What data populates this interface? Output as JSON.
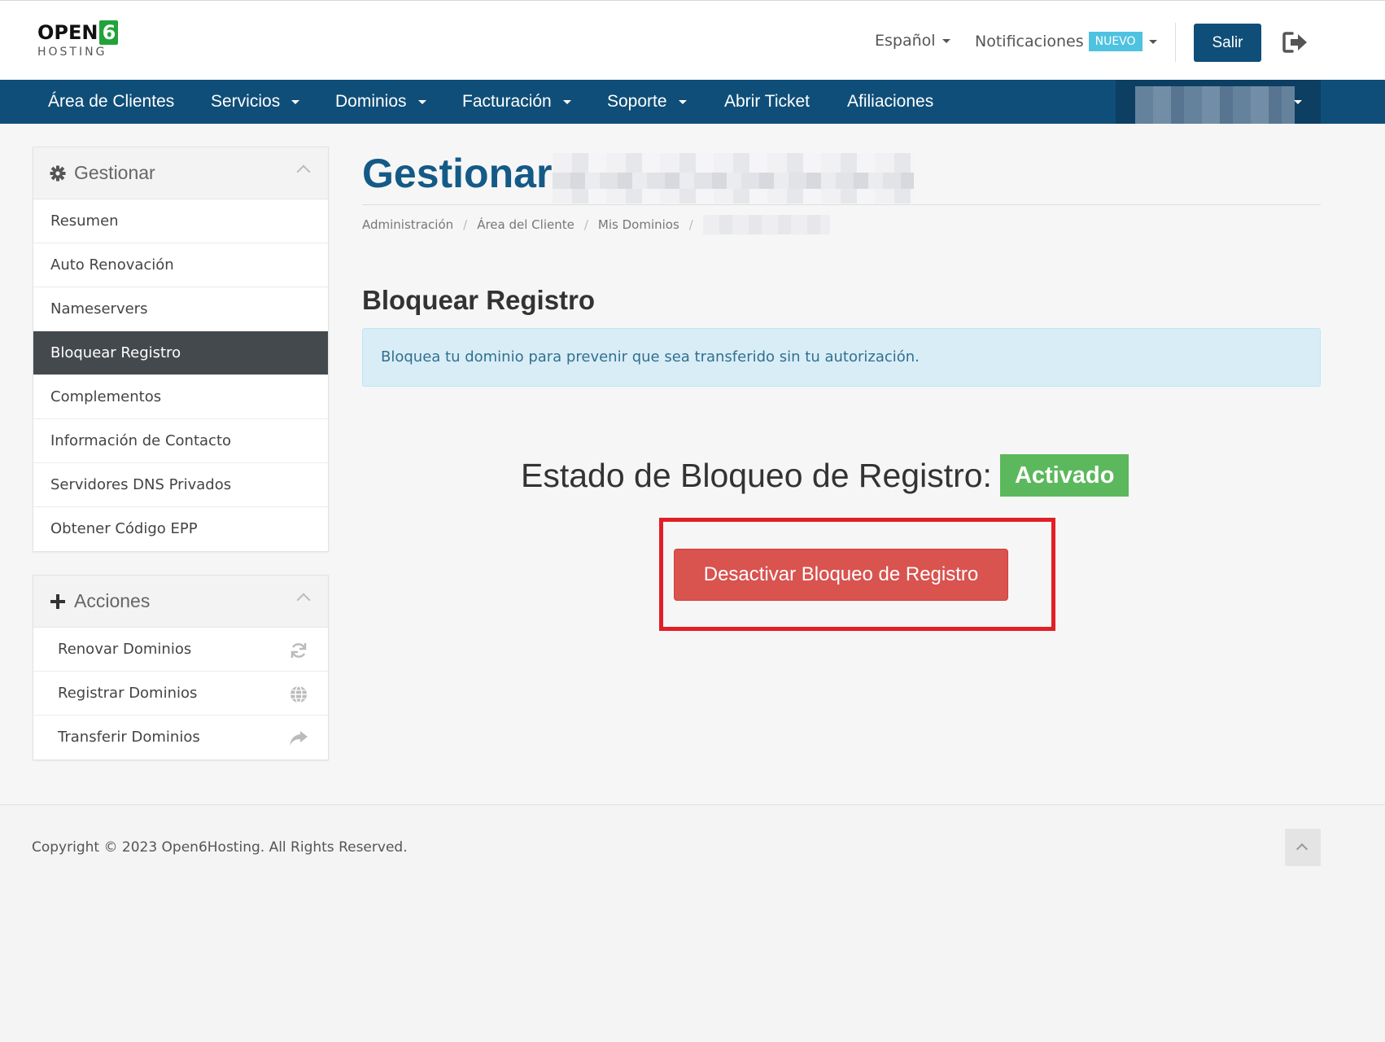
{
  "header": {
    "logo_text": "OPEN",
    "logo_digit": "6",
    "logo_sub": "HOSTING",
    "language": "Español",
    "notifications": "Notificaciones",
    "notifications_badge": "NUEVO",
    "logout_label": "Salir"
  },
  "nav": {
    "items": [
      "Área de Clientes",
      "Servicios",
      "Dominios",
      "Facturación",
      "Soporte",
      "Abrir Ticket",
      "Afiliaciones"
    ]
  },
  "sidebar": {
    "manage_title": "Gestionar",
    "manage_items": [
      "Resumen",
      "Auto Renovación",
      "Nameservers",
      "Bloquear Registro",
      "Complementos",
      "Información de Contacto",
      "Servidores DNS Privados",
      "Obtener Código EPP"
    ],
    "active_item": "Bloquear Registro",
    "actions_title": "Acciones",
    "action_items": [
      {
        "label": "Renovar Dominios",
        "icon": "refresh-icon"
      },
      {
        "label": "Registrar Dominios",
        "icon": "globe-icon"
      },
      {
        "label": "Transferir Dominios",
        "icon": "share-icon"
      }
    ]
  },
  "main": {
    "title": "Gestionar",
    "breadcrumb": [
      "Administración",
      "Área del Cliente",
      "Mis Dominios"
    ],
    "section_title": "Bloquear Registro",
    "info_text": "Bloquea tu dominio para prevenir que sea transferido sin tu autorización.",
    "status_label": "Estado de Bloqueo de Registro:",
    "status_value": "Activado",
    "deactivate_button": "Desactivar Bloqueo de Registro"
  },
  "footer": {
    "copyright": "Copyright © 2023 Open6Hosting. All Rights Reserved."
  },
  "colors": {
    "primary": "#0f4e78",
    "success": "#5cb85c",
    "danger": "#d9534f",
    "highlight": "#e11f26",
    "info_bg": "#d9edf7"
  }
}
